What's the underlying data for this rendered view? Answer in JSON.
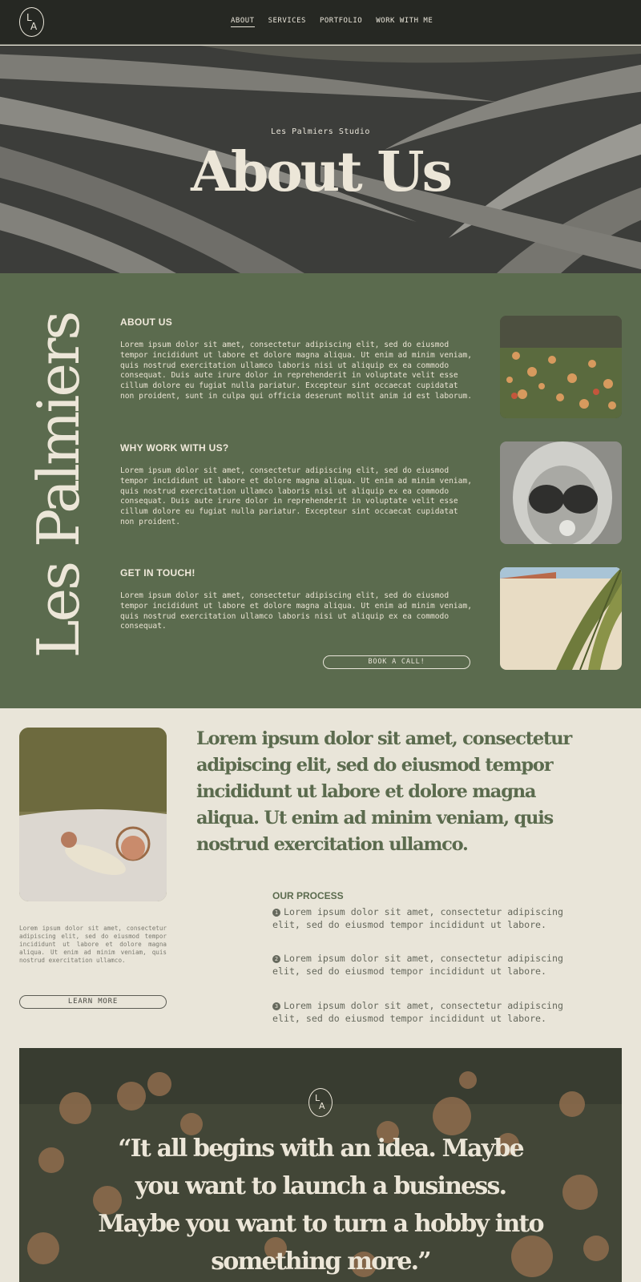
{
  "nav": {
    "logo": {
      "top": "L",
      "bottom": "A"
    },
    "links": [
      "ABOUT",
      "SERVICES",
      "PORTFOLIO",
      "WORK WITH ME"
    ]
  },
  "hero": {
    "subtitle": "Les Palmiers Studio",
    "title": "About Us"
  },
  "green": {
    "vertical_title": "Les Palmiers",
    "blocks": [
      {
        "heading": "ABOUT US",
        "text": "Lorem ipsum dolor sit amet, consectetur adipiscing elit, sed do eiusmod tempor incididunt ut labore et dolore magna aliqua. Ut enim ad minim veniam, quis nostrud exercitation ullamco laboris nisi ut aliquip ex ea commodo consequat. Duis aute irure dolor in reprehenderit in voluptate velit esse cillum dolore eu fugiat nulla pariatur. Excepteur sint occaecat cupidatat non proident, sunt in culpa qui officia deserunt mollit anim id est laborum."
      },
      {
        "heading": "WHY WORK WITH US?",
        "text": "Lorem ipsum dolor sit amet, consectetur adipiscing elit, sed do eiusmod tempor incididunt ut labore et dolore magna aliqua. Ut enim ad minim veniam, quis nostrud exercitation ullamco laboris nisi ut aliquip ex ea commodo consequat. Duis aute irure dolor in reprehenderit in voluptate velit esse cillum dolore eu fugiat nulla pariatur. Excepteur sint occaecat cupidatat non proident."
      },
      {
        "heading": "GET IN TOUCH!",
        "text": "Lorem ipsum dolor sit amet, consectetur adipiscing elit, sed do eiusmod tempor incididunt ut labore et dolore magna aliqua. Ut enim ad minim veniam, quis nostrud exercitation ullamco laboris nisi ut aliquip ex ea commodo consequat."
      }
    ],
    "book_button": "BOOK A CALL!"
  },
  "intro": {
    "small_text": "Lorem ipsum dolor sit amet, consectetur adipiscing elit, sed do eiusmod tempor incididunt ut labore et dolore magna aliqua. Ut enim ad minim veniam, quis nostrud exercitation ullamco.",
    "learn_button": "LEARN MORE",
    "big_quote": "Lorem ipsum dolor sit amet, consectetur adipiscing elit, sed do eiusmod tempor incididunt ut labore et dolore magna aliqua. Ut enim ad minim veniam, quis nostrud exercitation ullamco."
  },
  "process": {
    "heading": "OUR PROCESS",
    "steps": [
      {
        "num": "1",
        "text": "Lorem ipsum dolor sit amet, consectetur adipiscing elit, sed do eiusmod tempor incididunt ut labore."
      },
      {
        "num": "2",
        "text": "Lorem ipsum dolor sit amet, consectetur adipiscing elit, sed do eiusmod tempor incididunt ut labore."
      },
      {
        "num": "3",
        "text": "Lorem ipsum dolor sit amet, consectetur adipiscing elit, sed do eiusmod tempor incididunt ut labore."
      }
    ]
  },
  "banner": {
    "logo": {
      "top": "L",
      "bottom": "A"
    },
    "quote": "“It all begins with an idea. Maybe you want to launch a business. Maybe you want to turn a hobby into something more.”"
  },
  "colors": {
    "nav_bg": "#262823",
    "forest_green": "#5b6b4e",
    "cream": "#e9e5d9",
    "text_cream": "#ece6d8"
  }
}
